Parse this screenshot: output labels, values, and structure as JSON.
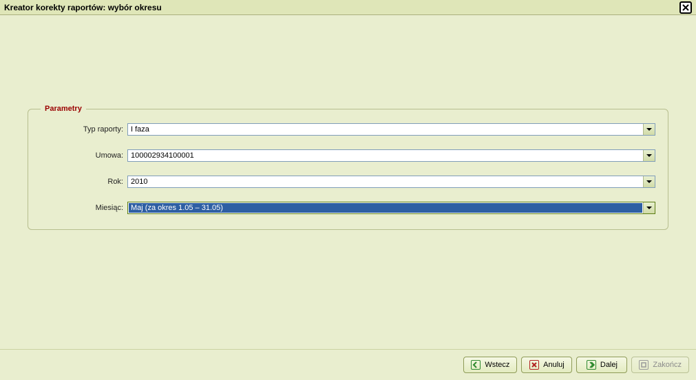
{
  "title": "Kreator korekty raportów: wybór okresu",
  "legend": "Parametry",
  "labels": {
    "typ": "Typ raporty:",
    "umowa": "Umowa:",
    "rok": "Rok:",
    "miesiac": "Miesiąc:"
  },
  "values": {
    "typ": "I faza",
    "umowa": "100002934100001",
    "rok": "2010",
    "miesiac": "Maj (za okres 1.05 – 31.05)"
  },
  "buttons": {
    "wstecz": "Wstecz",
    "anuluj": "Anuluj",
    "dalej": "Dalej",
    "zakoncz": "Zakończ"
  }
}
